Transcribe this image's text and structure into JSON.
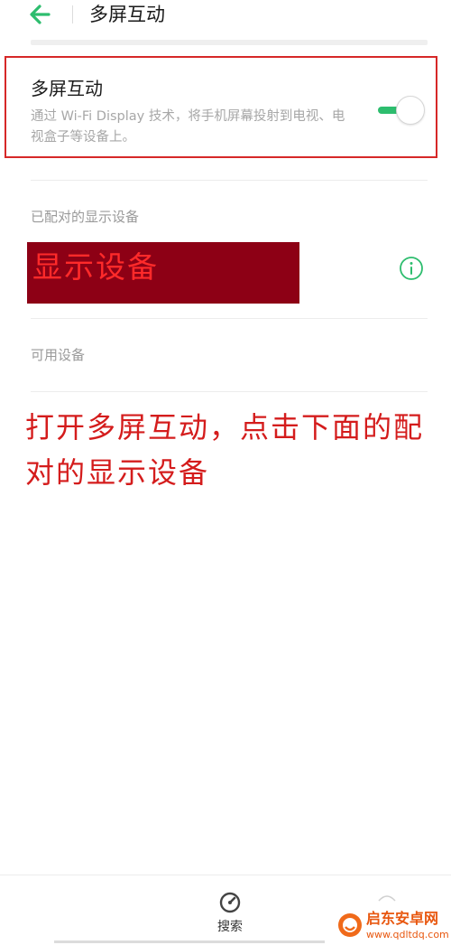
{
  "header": {
    "title": "多屏互动",
    "back_icon": "arrow-left-icon"
  },
  "multiscreen": {
    "title": "多屏互动",
    "description": "通过 Wi-Fi Display 技术，将手机屏幕投射到电视、电视盒子等设备上。",
    "enabled": true
  },
  "paired_section": {
    "label": "已配对的显示设备",
    "devices": [
      {
        "name": "显示设备",
        "info_icon": "info-icon"
      }
    ]
  },
  "available_section": {
    "label": "可用设备"
  },
  "annotation": {
    "text": "打开多屏互动，点击下面的配对的显示设备"
  },
  "bottom_bar": {
    "search_label": "搜索",
    "search_icon": "gauge-icon"
  },
  "watermark": {
    "name": "启东安卓网",
    "url": "www.qdltdq.com"
  },
  "colors": {
    "accent": "#2dbd6e",
    "highlight_border": "#d62828",
    "device_bg": "#8d0015",
    "device_text": "#ff2a2a",
    "annotation": "#d41c1c"
  }
}
